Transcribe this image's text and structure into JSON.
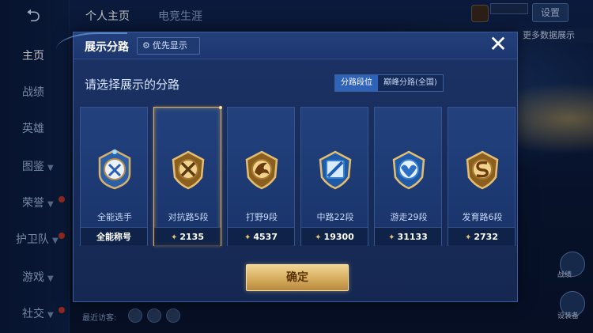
{
  "background": {
    "top_tabs": [
      "个人主页",
      "电竞生涯"
    ],
    "nav": [
      {
        "label": "主页",
        "active": true,
        "badge": false
      },
      {
        "label": "战绩",
        "active": false,
        "badge": false
      },
      {
        "label": "英雄",
        "active": false,
        "badge": false
      },
      {
        "label": "图鉴",
        "active": false,
        "badge": false
      },
      {
        "label": "荣誉",
        "active": false,
        "badge": true
      },
      {
        "label": "护卫队",
        "active": false,
        "badge": true
      },
      {
        "label": "游戏",
        "active": false,
        "badge": false
      },
      {
        "label": "社交",
        "active": false,
        "badge": true
      }
    ],
    "top_right_button": "设置",
    "right_banner": "更多数据展示",
    "visitors_label": "最近访客:",
    "right_buttons": [
      "战绩",
      "设装备"
    ]
  },
  "dialog": {
    "title": "展示分路",
    "priority_label": "优先显示",
    "subtitle": "请选择展示的分路",
    "segments": [
      {
        "label": "分路段位",
        "active": true
      },
      {
        "label": "巅峰分路(全国)",
        "active": false
      }
    ],
    "cards": [
      {
        "name": "全能选手",
        "footer": "全能称号",
        "score": "",
        "selected": false,
        "icon": "all-round-emblem-icon"
      },
      {
        "name": "对抗路5段",
        "footer": "",
        "score": "2135",
        "selected": true,
        "icon": "clash-lane-emblem-icon"
      },
      {
        "name": "打野9段",
        "footer": "",
        "score": "4537",
        "selected": false,
        "icon": "jungle-emblem-icon"
      },
      {
        "name": "中路22段",
        "footer": "",
        "score": "19300",
        "selected": false,
        "icon": "mid-lane-emblem-icon"
      },
      {
        "name": "游走29段",
        "footer": "",
        "score": "31133",
        "selected": false,
        "icon": "roam-emblem-icon"
      },
      {
        "name": "发育路6段",
        "footer": "",
        "score": "2732",
        "selected": false,
        "icon": "farm-lane-emblem-icon"
      }
    ],
    "confirm_label": "确定"
  },
  "colors": {
    "accent_gold": "#e2b566",
    "panel_blue": "#1c3366",
    "segment_active": "#2f63b8"
  }
}
